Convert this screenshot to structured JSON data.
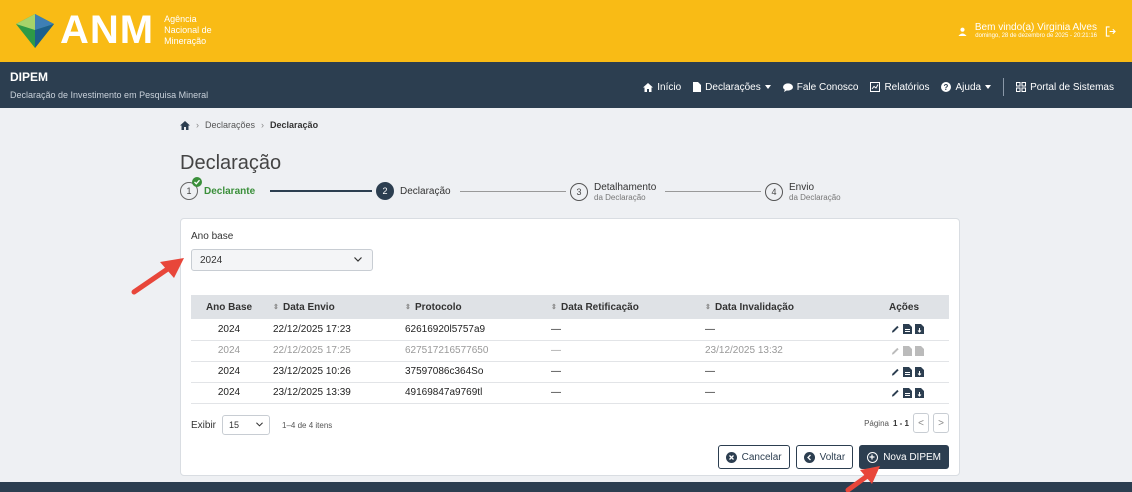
{
  "header": {
    "logo_text": "ANM",
    "logo_sub": [
      "Agência",
      "Nacional de",
      "Mineração"
    ],
    "user_name": "Bem vindo(a) Virginia Alves",
    "user_date": "domingo, 28 de dezembro de 2025 - 20:21:16"
  },
  "nav": {
    "app_title": "DIPEM",
    "app_subtitle": "Declaração de Investimento em Pesquisa Mineral",
    "items": {
      "inicio": "Início",
      "declaracoes": "Declarações",
      "fale": "Fale Conosco",
      "relatorios": "Relatórios",
      "ajuda": "Ajuda",
      "portal": "Portal de Sistemas"
    }
  },
  "breadcrumb": {
    "level1": "Declarações",
    "current": "Declaração"
  },
  "page_title": "Declaração",
  "stepper": {
    "steps": [
      {
        "num": "1",
        "label": "Declarante",
        "sub": ""
      },
      {
        "num": "2",
        "label": "Declaração",
        "sub": ""
      },
      {
        "num": "3",
        "label": "Detalhamento",
        "sub": "da Declaração"
      },
      {
        "num": "4",
        "label": "Envio",
        "sub": "da Declaração"
      }
    ]
  },
  "form": {
    "ano_base_label": "Ano base",
    "ano_base_value": "2024"
  },
  "table": {
    "headers": [
      "Ano Base",
      "Data Envio",
      "Protocolo",
      "Data Retificação",
      "Data Invalidação",
      "Ações"
    ],
    "rows": [
      {
        "ano": "2024",
        "envio": "22/12/2025 17:23",
        "protocolo": "62616920l5757a9",
        "retificacao": "—",
        "invalidacao": "—"
      },
      {
        "ano": "2024",
        "envio": "22/12/2025 17:25",
        "protocolo": "627517216577650",
        "retificacao": "—",
        "invalidacao": "23/12/2025 13:32"
      },
      {
        "ano": "2024",
        "envio": "23/12/2025 10:26",
        "protocolo": "37597086c364So",
        "retificacao": "—",
        "invalidacao": "—"
      },
      {
        "ano": "2024",
        "envio": "23/12/2025 13:39",
        "protocolo": "49169847a9769tl",
        "retificacao": "—",
        "invalidacao": "—"
      }
    ]
  },
  "pagination": {
    "exibir_label": "Exibir",
    "per_page": "15",
    "range": "1–4 de 4 itens",
    "page_label": "Página",
    "page_value": "1 - 1",
    "prev": "<",
    "next": ">"
  },
  "buttons": {
    "cancel": "Cancelar",
    "back": "Voltar",
    "new": "Nova DIPEM"
  },
  "colors": {
    "brand_yellow": "#f9bb15",
    "navy": "#2c3e50",
    "success": "#3a8f3a",
    "arrow_red": "#e8463a"
  }
}
